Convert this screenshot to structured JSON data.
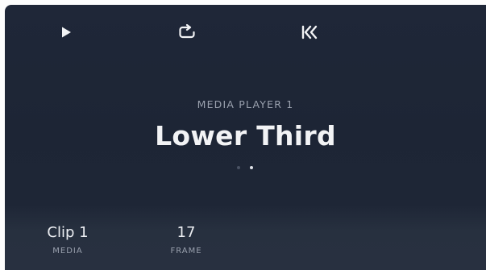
{
  "transport": {
    "play_icon": "play-icon",
    "loop_icon": "loop-icon",
    "rewind_icon": "rewind-to-start-icon"
  },
  "player": {
    "label": "MEDIA PLAYER 1",
    "title": "Lower Third",
    "pages_total": 2,
    "page_active": 2
  },
  "stats": {
    "media_value": "Clip 1",
    "media_label": "MEDIA",
    "frame_value": "17",
    "frame_label": "FRAME"
  },
  "colors": {
    "panel_background": "#1e2636",
    "title_text": "#f2f3f5",
    "muted_text": "#9aa1ae"
  }
}
